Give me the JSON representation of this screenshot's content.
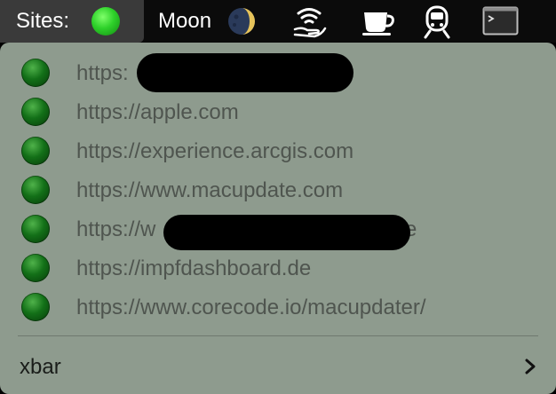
{
  "menubar": {
    "sites_label": "Sites:",
    "sites_status_color": "#2ed12a",
    "moon_label": "Moon",
    "icons": [
      "moon-phase-icon",
      "wifi-hand-icon",
      "coffee-cup-icon",
      "train-icon",
      "terminal-icon"
    ]
  },
  "menu": {
    "sites": [
      {
        "url": "https:",
        "status_color": "#137018",
        "redacted": true
      },
      {
        "url": "https://apple.com",
        "status_color": "#137018"
      },
      {
        "url": "https://experience.arcgis.com",
        "status_color": "#137018"
      },
      {
        "url": "https://www.macupdate.com",
        "status_color": "#137018"
      },
      {
        "url": "https://w",
        "tail": "e",
        "status_color": "#137018",
        "redacted": true
      },
      {
        "url": "https://impfdashboard.de",
        "status_color": "#137018"
      },
      {
        "url": "https://www.corecode.io/macupdater/",
        "status_color": "#137018"
      }
    ],
    "app_item": {
      "label": "xbar",
      "submenu_icon": "chevron-right-icon"
    }
  }
}
